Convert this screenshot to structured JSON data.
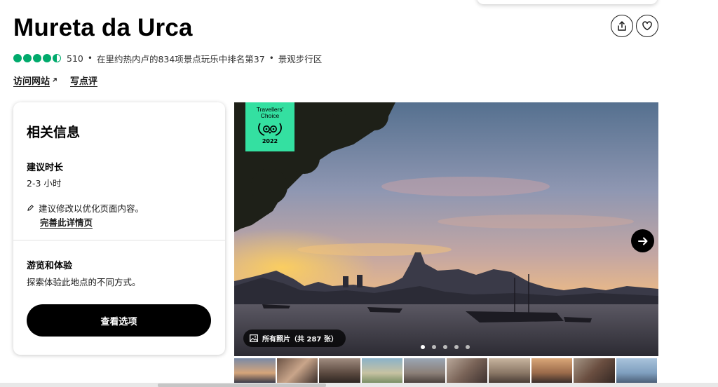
{
  "header": {
    "title": "Mureta da Urca",
    "share_icon": "share-icon",
    "save_icon": "heart-icon"
  },
  "rating": {
    "bubbles": 4.5,
    "bubble_color": "#00aa6c",
    "review_count": "510",
    "rank_text": "在里约热内卢的834项景点玩乐中排名第37",
    "category": "景观步行区"
  },
  "links": {
    "website": "访问网站",
    "website_icon": "external-link-icon",
    "write_review": "写点评"
  },
  "info_card": {
    "heading": "相关信息",
    "duration_label": "建议时长",
    "duration_value": "2-3 小时",
    "suggest_text": "建议修改以优化页面内容。",
    "improve_link": "完善此详情页",
    "tours_label": "游览和体验",
    "tours_desc": "探索体验此地点的不同方式。",
    "cta_label": "查看选项"
  },
  "gallery": {
    "badge_line1": "Travellers'",
    "badge_line2": "Choice",
    "badge_year": "2022",
    "badge_color": "#34e0a1",
    "all_photos_label": "所有照片（共 287 张）",
    "active_dot": 1,
    "dot_count": 5,
    "thumbnail_count": 10
  }
}
